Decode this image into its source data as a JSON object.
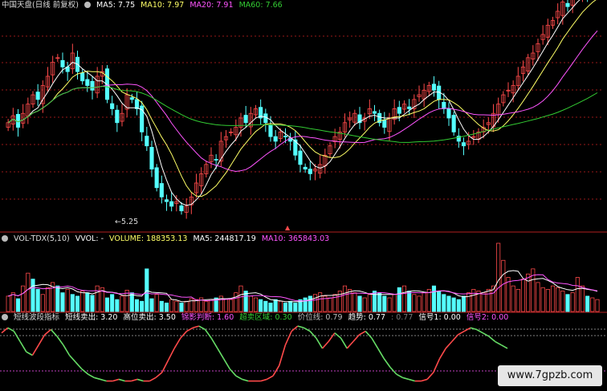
{
  "colors": {
    "up": "#ff4a4a",
    "down": "#54ffff",
    "ma5": "#ffffff",
    "ma10": "#ffff66",
    "ma20": "#ff55ff",
    "ma60": "#33cc33",
    "dashed": "#cc2222"
  },
  "price_panel": {
    "title": "中国天盘(日线 前复权)",
    "legend": [
      {
        "key": "MA5",
        "label": "MA5: 7.75",
        "color": "#ffffff"
      },
      {
        "key": "MA10",
        "label": "MA10: 7.97",
        "color": "#ffff66"
      },
      {
        "key": "MA20",
        "label": "MA20: 7.91",
        "color": "#ff55ff"
      },
      {
        "key": "MA60",
        "label": "MA60: 7.66",
        "color": "#33cc33"
      }
    ],
    "low_annotation": "5.25"
  },
  "volume_panel": {
    "title": "VOL-TDX(5,10)",
    "legend": [
      {
        "label": "VVOL: -",
        "color": "#ffffff"
      },
      {
        "label": "VOLUME: 188353.13",
        "color": "#ffff66"
      },
      {
        "label": "MA5: 244817.19",
        "color": "#ffffff"
      },
      {
        "label": "MA10: 365843.03",
        "color": "#ff55ff"
      }
    ]
  },
  "indicator_panel": {
    "title": "短线波段指标",
    "legend": [
      {
        "label": "短线卖出: 3.20",
        "color": "#ffffff"
      },
      {
        "label": "高位卖出: 3.50",
        "color": "#ffffff"
      },
      {
        "label": "锦影判断: 1.60",
        "color": "#ff55ff"
      },
      {
        "label": "超卖区域: 0.30",
        "color": "#33cc33"
      },
      {
        "label": "价位线: 0.79",
        "color": "#bbbbbb"
      },
      {
        "label": "趋势: 0.77",
        "color": "#ffffff"
      },
      {
        "label": ": 0.77",
        "color": "#777777"
      },
      {
        "label": "信号1: 0.00",
        "color": "#ffffff"
      },
      {
        "label": "信号2: 0.00",
        "color": "#ff55ff"
      }
    ]
  },
  "watermark": "www.7gpzb.com",
  "chart_data": [
    {
      "type": "candlestick",
      "title": "中国天盘(日线 前复权)",
      "count": 120,
      "close": [
        7.2,
        7.35,
        7.1,
        7.4,
        7.6,
        7.8,
        7.7,
        8.0,
        8.2,
        8.5,
        8.6,
        8.4,
        8.3,
        8.7,
        8.3,
        8.1,
        8.0,
        7.9,
        8.2,
        8.3,
        7.7,
        7.5,
        7.2,
        7.4,
        7.8,
        7.7,
        7.5,
        7.0,
        6.7,
        6.2,
        5.8,
        5.6,
        5.5,
        5.4,
        5.5,
        5.3,
        5.4,
        5.6,
        5.9,
        6.1,
        6.3,
        6.5,
        6.4,
        6.8,
        6.9,
        7.0,
        7.1,
        7.3,
        7.2,
        7.4,
        7.5,
        7.3,
        7.2,
        6.9,
        6.8,
        7.0,
        6.9,
        6.8,
        6.5,
        6.3,
        6.2,
        6.1,
        6.2,
        6.3,
        6.5,
        6.7,
        6.9,
        7.0,
        7.2,
        7.3,
        7.4,
        7.2,
        7.3,
        7.5,
        7.4,
        7.2,
        7.1,
        7.3,
        7.5,
        7.4,
        7.6,
        7.5,
        7.7,
        7.8,
        7.9,
        8.0,
        7.9,
        7.7,
        7.5,
        7.3,
        7.0,
        6.8,
        6.7,
        6.8,
        6.9,
        7.0,
        7.1,
        7.2,
        7.4,
        7.6,
        7.8,
        7.9,
        8.0,
        8.2,
        8.4,
        8.6,
        8.7,
        8.9,
        9.1,
        9.3,
        9.4,
        9.6,
        9.8,
        9.7,
        9.9,
        10.0,
        10.1,
        10.0,
        10.1,
        10.1
      ],
      "ma5_last": 7.75,
      "ma10_last": 7.97,
      "ma20_last": 7.91,
      "ma60_last": 7.66,
      "low_label": 5.25,
      "ylim": [
        5.0,
        9.6
      ]
    },
    {
      "type": "bar",
      "title": "VOL-TDX(5,10)",
      "volume_last": 188353.13,
      "ma5_last": 244817.19,
      "ma10_last": 365843.03,
      "values": [
        18,
        22,
        15,
        30,
        45,
        38,
        26,
        20,
        28,
        34,
        30,
        22,
        26,
        20,
        18,
        24,
        22,
        19,
        30,
        28,
        16,
        20,
        14,
        18,
        25,
        22,
        14,
        12,
        50,
        15,
        20,
        12,
        10,
        14,
        12,
        10,
        12,
        15,
        14,
        16,
        12,
        14,
        16,
        18,
        15,
        14,
        22,
        30,
        24,
        18,
        16,
        14,
        12,
        10,
        14,
        12,
        10,
        12,
        10,
        14,
        16,
        18,
        20,
        22,
        18,
        16,
        20,
        24,
        30,
        26,
        22,
        18,
        16,
        20,
        24,
        22,
        18,
        16,
        20,
        28,
        30,
        24,
        20,
        18,
        22,
        26,
        30,
        24,
        20,
        18,
        16,
        14,
        18,
        22,
        26,
        24,
        22,
        26,
        30,
        80,
        60,
        40,
        30,
        26,
        38,
        44,
        50,
        34,
        28,
        26,
        30,
        28,
        24,
        20,
        22,
        40,
        30,
        18,
        16,
        14
      ],
      "up_flags": [
        1,
        1,
        0,
        1,
        1,
        0,
        0,
        1,
        1,
        1,
        0,
        0,
        1,
        0,
        0,
        1,
        0,
        0,
        1,
        1,
        0,
        0,
        0,
        1,
        1,
        0,
        0,
        0,
        0,
        0,
        1,
        0,
        0,
        1,
        1,
        0,
        1,
        1,
        1,
        1,
        1,
        1,
        0,
        1,
        1,
        1,
        1,
        1,
        0,
        1,
        1,
        0,
        0,
        0,
        0,
        1,
        0,
        0,
        0,
        0,
        0,
        0,
        1,
        1,
        1,
        1,
        1,
        1,
        1,
        1,
        1,
        0,
        1,
        1,
        0,
        0,
        0,
        1,
        1,
        0,
        1,
        0,
        1,
        1,
        1,
        1,
        0,
        0,
        0,
        0,
        0,
        0,
        0,
        1,
        1,
        1,
        1,
        1,
        1,
        1,
        1,
        1,
        1,
        1,
        1,
        1,
        1,
        1,
        1,
        1,
        1,
        1,
        1,
        0,
        1,
        1,
        1,
        0,
        1,
        1
      ]
    },
    {
      "type": "line",
      "title": "短线波段指标",
      "values": [
        3.1,
        3.4,
        3.2,
        2.6,
        2.0,
        1.8,
        2.4,
        3.0,
        3.3,
        2.9,
        2.4,
        1.8,
        1.4,
        1.0,
        0.7,
        0.5,
        0.4,
        0.3,
        0.3,
        0.4,
        0.3,
        0.3,
        0.4,
        0.3,
        0.3,
        0.5,
        0.8,
        1.5,
        2.2,
        2.8,
        3.2,
        3.4,
        3.5,
        3.3,
        2.8,
        2.2,
        1.6,
        1.0,
        0.6,
        0.4,
        0.3,
        0.3,
        0.3,
        0.4,
        0.6,
        1.2,
        2.4,
        3.2,
        3.5,
        3.4,
        3.2,
        2.8,
        2.2,
        2.6,
        3.1,
        2.8,
        2.2,
        2.6,
        3.0,
        3.2,
        2.8,
        2.2,
        1.6,
        1.1,
        0.7,
        0.5,
        0.4,
        0.3,
        0.3,
        0.4,
        0.8,
        1.6,
        2.2,
        2.6,
        3.0,
        3.2,
        3.4,
        3.3,
        3.1,
        2.9,
        2.6,
        2.4,
        2.2
      ]
    }
  ]
}
